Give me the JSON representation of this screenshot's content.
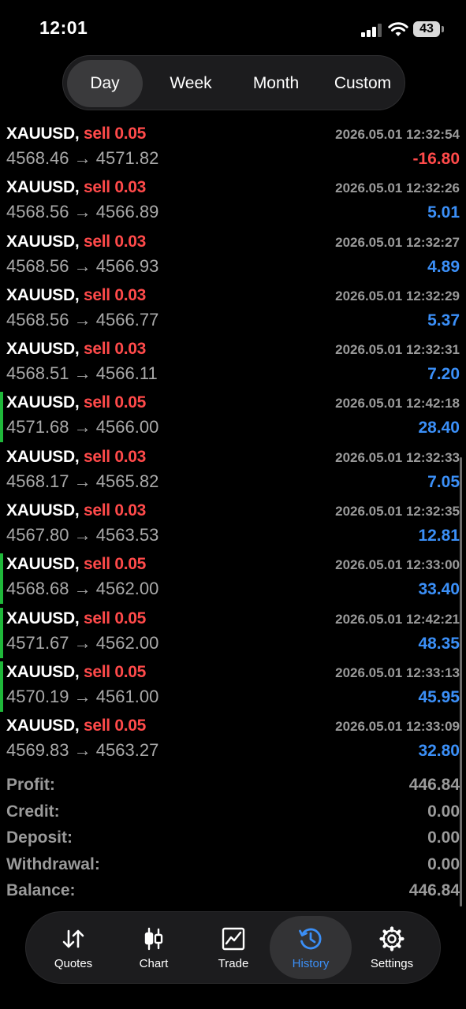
{
  "status_bar": {
    "time": "12:01",
    "battery": "43"
  },
  "period_tabs": [
    {
      "label": "Day",
      "active": true
    },
    {
      "label": "Week",
      "active": false
    },
    {
      "label": "Month",
      "active": false
    },
    {
      "label": "Custom",
      "active": false
    }
  ],
  "deals": [
    {
      "symbol": "XAUUSD,",
      "side": "sell",
      "volume": "0.05",
      "time": "2026.05.01 12:32:54",
      "open": "4568.46",
      "arrow": "→",
      "close": "4571.82",
      "profit": "-16.80",
      "marked": false
    },
    {
      "symbol": "XAUUSD,",
      "side": "sell",
      "volume": "0.03",
      "time": "2026.05.01 12:32:26",
      "open": "4568.56",
      "arrow": "→",
      "close": "4566.89",
      "profit": "5.01",
      "marked": false
    },
    {
      "symbol": "XAUUSD,",
      "side": "sell",
      "volume": "0.03",
      "time": "2026.05.01 12:32:27",
      "open": "4568.56",
      "arrow": "→",
      "close": "4566.93",
      "profit": "4.89",
      "marked": false
    },
    {
      "symbol": "XAUUSD,",
      "side": "sell",
      "volume": "0.03",
      "time": "2026.05.01 12:32:29",
      "open": "4568.56",
      "arrow": "→",
      "close": "4566.77",
      "profit": "5.37",
      "marked": false
    },
    {
      "symbol": "XAUUSD,",
      "side": "sell",
      "volume": "0.03",
      "time": "2026.05.01 12:32:31",
      "open": "4568.51",
      "arrow": "→",
      "close": "4566.11",
      "profit": "7.20",
      "marked": false
    },
    {
      "symbol": "XAUUSD,",
      "side": "sell",
      "volume": "0.05",
      "time": "2026.05.01 12:42:18",
      "open": "4571.68",
      "arrow": "→",
      "close": "4566.00",
      "profit": "28.40",
      "marked": true
    },
    {
      "symbol": "XAUUSD,",
      "side": "sell",
      "volume": "0.03",
      "time": "2026.05.01 12:32:33",
      "open": "4568.17",
      "arrow": "→",
      "close": "4565.82",
      "profit": "7.05",
      "marked": false
    },
    {
      "symbol": "XAUUSD,",
      "side": "sell",
      "volume": "0.03",
      "time": "2026.05.01 12:32:35",
      "open": "4567.80",
      "arrow": "→",
      "close": "4563.53",
      "profit": "12.81",
      "marked": false
    },
    {
      "symbol": "XAUUSD,",
      "side": "sell",
      "volume": "0.05",
      "time": "2026.05.01 12:33:00",
      "open": "4568.68",
      "arrow": "→",
      "close": "4562.00",
      "profit": "33.40",
      "marked": true
    },
    {
      "symbol": "XAUUSD,",
      "side": "sell",
      "volume": "0.05",
      "time": "2026.05.01 12:42:21",
      "open": "4571.67",
      "arrow": "→",
      "close": "4562.00",
      "profit": "48.35",
      "marked": true
    },
    {
      "symbol": "XAUUSD,",
      "side": "sell",
      "volume": "0.05",
      "time": "2026.05.01 12:33:13",
      "open": "4570.19",
      "arrow": "→",
      "close": "4561.00",
      "profit": "45.95",
      "marked": true
    },
    {
      "symbol": "XAUUSD,",
      "side": "sell",
      "volume": "0.05",
      "time": "2026.05.01 12:33:09",
      "open": "4569.83",
      "arrow": "→",
      "close": "4563.27",
      "profit": "32.80",
      "marked": false
    }
  ],
  "summary": [
    {
      "key": "profit",
      "label": "Profit:",
      "value": "446.84"
    },
    {
      "key": "credit",
      "label": "Credit:",
      "value": "0.00"
    },
    {
      "key": "deposit",
      "label": "Deposit:",
      "value": "0.00"
    },
    {
      "key": "withdrawal",
      "label": "Withdrawal:",
      "value": "0.00"
    },
    {
      "key": "balance",
      "label": "Balance:",
      "value": "446.84"
    }
  ],
  "tab_bar": [
    {
      "label": "Quotes",
      "icon": "quotes-arrows-icon",
      "active": false
    },
    {
      "label": "Chart",
      "icon": "candlestick-icon",
      "active": false
    },
    {
      "label": "Trade",
      "icon": "trade-chart-icon",
      "active": false
    },
    {
      "label": "History",
      "icon": "history-clock-icon",
      "active": true
    },
    {
      "label": "Settings",
      "icon": "gear-icon",
      "active": false
    }
  ],
  "colors": {
    "sell": "#ff4a4a",
    "profit_positive": "#3b8ff7",
    "profit_negative": "#ff4a4a",
    "marker": "#1fb83a",
    "active_tab": "#3b8ff7"
  }
}
